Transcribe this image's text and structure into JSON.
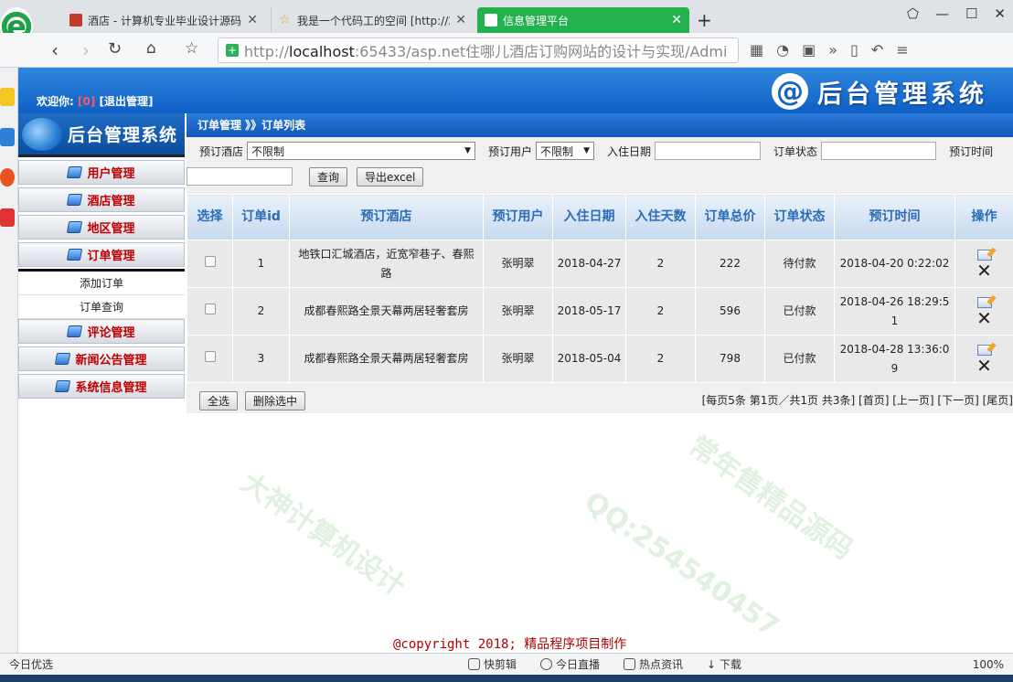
{
  "browser": {
    "tabs": [
      {
        "label": "酒店 - 计算机专业毕业设计源码"
      },
      {
        "label": "我是一个代码工的空间 [http://2"
      },
      {
        "label": "信息管理平台"
      }
    ],
    "url_prefix": "http://",
    "url_host": "localhost",
    "url_rest": ":65433/asp.net住哪儿酒店订购网站的设计与实现/Admi",
    "status_left": "今日优选",
    "status_items": [
      "快剪辑",
      "今日直播",
      "热点资讯"
    ],
    "status_download": "下载",
    "zoom": "100%"
  },
  "header": {
    "welcome_label": "欢迎你:",
    "username": "[0]",
    "logout": "[退出管理]",
    "system_title": "后台管理系统"
  },
  "menu": {
    "title": "后台管理系统",
    "items": [
      {
        "label": "用户管理"
      },
      {
        "label": "酒店管理"
      },
      {
        "label": "地区管理"
      },
      {
        "label": "订单管理"
      },
      {
        "label": "评论管理"
      },
      {
        "label": "新闻公告管理"
      },
      {
        "label": "系统信息管理"
      }
    ],
    "submenu": [
      "添加订单",
      "订单查询"
    ]
  },
  "main": {
    "breadcrumb": "订单管理 》》订单列表",
    "filters": {
      "hotel_label": "预订酒店",
      "hotel_value": "不限制",
      "user_label": "预订用户",
      "user_value": "不限制",
      "checkin_label": "入住日期",
      "checkin_value": "",
      "status_label": "订单状态",
      "status_value": "",
      "ordertime_label": "预订时间"
    },
    "search_value": "",
    "search_button": "查询",
    "export_button": "导出excel",
    "columns": [
      "选择",
      "订单id",
      "预订酒店",
      "预订用户",
      "入住日期",
      "入住天数",
      "订单总价",
      "订单状态",
      "预订时间",
      "操作"
    ],
    "rows": [
      {
        "id": "1",
        "hotel": "地铁口汇城酒店，近宽窄巷子、春熙路",
        "user": "张明翠",
        "checkin": "2018-04-27",
        "days": "2",
        "total": "222",
        "status": "待付款",
        "time": "2018-04-20 0:22:02"
      },
      {
        "id": "2",
        "hotel": "成都春熙路全景天幕两居轻奢套房",
        "user": "张明翠",
        "checkin": "2018-05-17",
        "days": "2",
        "total": "596",
        "status": "已付款",
        "time": "2018-04-26 18:29:51"
      },
      {
        "id": "3",
        "hotel": "成都春熙路全景天幕两居轻奢套房",
        "user": "张明翠",
        "checkin": "2018-05-04",
        "days": "2",
        "total": "798",
        "status": "已付款",
        "time": "2018-04-28 13:36:09"
      }
    ],
    "select_all_button": "全选",
    "delete_selected_button": "删除选中",
    "pager": {
      "summary_a": "[每页",
      "per_page": "5",
      "summary_b": "条 第",
      "page": "1",
      "summary_c": "页／共",
      "total_pages": "1",
      "summary_d": "页 共",
      "total": "3",
      "summary_e": "条]",
      "first": "[首页]",
      "prev": "[上一页]",
      "next": "[下一页]",
      "last": "[尾页]"
    }
  },
  "copyright": "@copyright 2018; 精品程序项目制作",
  "watermarks": [
    "大神计算机设计",
    "QQ:254540457",
    "常年售精品源码"
  ]
}
